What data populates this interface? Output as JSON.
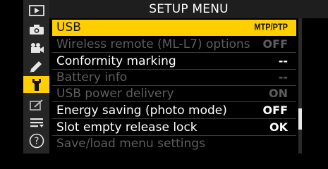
{
  "header": {
    "title": "SETUP MENU"
  },
  "sidebar": {
    "tabs": [
      {
        "icon": "playback-icon"
      },
      {
        "icon": "photo-shooting-icon"
      },
      {
        "icon": "movie-shooting-icon"
      },
      {
        "icon": "custom-settings-pencil-icon"
      },
      {
        "icon": "setup-wrench-icon",
        "active": true
      },
      {
        "icon": "retouch-icon"
      },
      {
        "icon": "my-menu-icon"
      },
      {
        "icon": "help-icon"
      }
    ]
  },
  "menu": {
    "items": [
      {
        "label": "USB",
        "value": "MTP/PTP",
        "state": "highlighted"
      },
      {
        "label": "Wireless remote (ML-L7) options",
        "value": "OFF",
        "state": "disabled"
      },
      {
        "label": "Conformity marking",
        "value": "--",
        "state": "enabled"
      },
      {
        "label": "Battery info",
        "value": "--",
        "state": "disabled"
      },
      {
        "label": "USB power delivery",
        "value": "ON",
        "state": "disabled"
      },
      {
        "label": "Energy saving (photo mode)",
        "value": "OFF",
        "state": "enabled"
      },
      {
        "label": "Slot empty release lock",
        "value": "OK",
        "state": "enabled"
      },
      {
        "label": "Save/load menu settings",
        "value": "",
        "state": "disabled"
      }
    ]
  },
  "colors": {
    "highlight": "#ffcf00",
    "disabled_text": "#5e5e5e",
    "text": "#ffffff",
    "background": "#000000"
  }
}
